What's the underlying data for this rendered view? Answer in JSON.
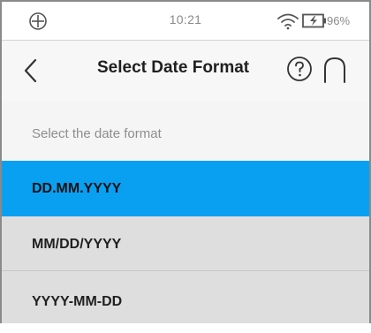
{
  "status_bar": {
    "time": "10:21",
    "battery_percent": "96%",
    "icons": [
      "network-globe-icon",
      "wifi-icon",
      "battery-charging-icon"
    ]
  },
  "header": {
    "title": "Select Date Format",
    "icons": [
      "back-chevron-icon",
      "help-icon",
      "home-icon"
    ]
  },
  "subtitle": "Select the date format",
  "options": [
    {
      "label": "DD.MM.YYYY",
      "selected": true
    },
    {
      "label": "MM/DD/YYYY",
      "selected": false
    },
    {
      "label": "YYYY-MM-DD",
      "selected": false
    }
  ],
  "colors": {
    "selected_background": "#0aa0f2",
    "option_background": "#dedede",
    "header_background": "#f7f7f7"
  }
}
